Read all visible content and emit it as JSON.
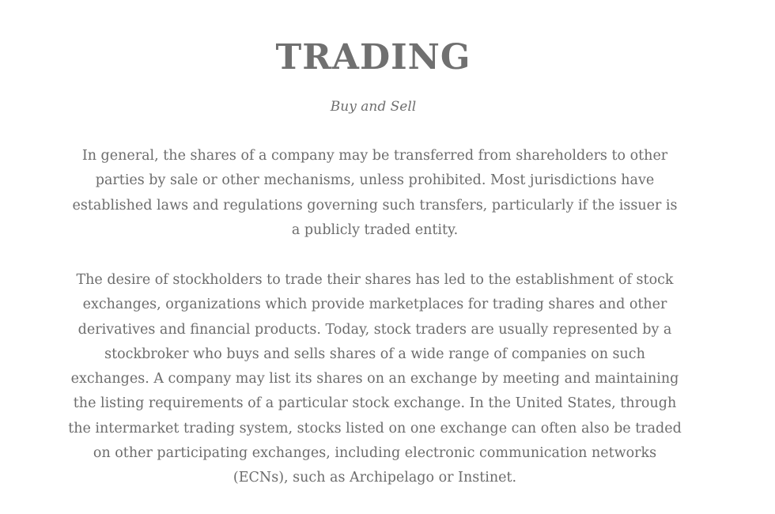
{
  "section": {
    "title": "TRADING",
    "subtitle": "Buy and Sell",
    "paragraphs": [
      "In general, the shares of a company may be transferred from shareholders to other parties by sale or other mechanisms, unless prohibited. Most jurisdictions have established laws and regulations governing such transfers, particularly if the issuer is a publicly traded entity.",
      "The desire of stockholders to trade their shares has led to the establishment of stock exchanges, organizations which provide marketplaces for trading shares and other derivatives and financial products. Today, stock traders are usually represented by a stockbroker who buys and sells shares of a wide range of companies on such exchanges. A company may list its shares on an exchange by meeting and maintaining the listing requirements of a particular stock exchange. In the United States, through the intermarket trading system, stocks listed on one exchange can often also be traded on other participating exchanges, including electronic communication networks (ECNs), such as Archipelago or Instinet."
    ]
  }
}
